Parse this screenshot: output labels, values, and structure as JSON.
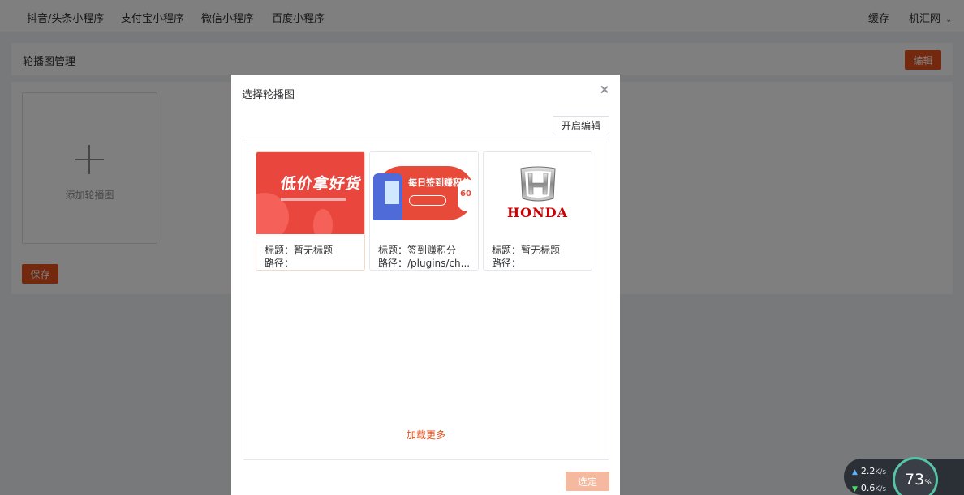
{
  "topnav": {
    "items": [
      "抖音/头条小程序",
      "支付宝小程序",
      "微信小程序",
      "百度小程序"
    ],
    "cache": "缓存",
    "account": "机汇网"
  },
  "panel": {
    "title": "轮播图管理",
    "edit_label": "编辑",
    "add_label": "添加轮播图",
    "save_label": "保存"
  },
  "dialog": {
    "title": "选择轮播图",
    "start_edit_label": "开启编辑",
    "load_more": "加载更多",
    "confirm_label": "选定",
    "cards": [
      {
        "title": "标题：暂无标题",
        "path": "路径：",
        "image_text": "低价拿好货"
      },
      {
        "title": "标题：签到赚积分",
        "path": "路径：/plugins/ch...",
        "image_text": "每日签到赚积分",
        "badge": "60"
      },
      {
        "title": "标题：暂无标题",
        "path": "路径：",
        "image_text": "HONDA"
      }
    ]
  },
  "net_widget": {
    "upload": "2.2",
    "download": "0.6",
    "unit": "K/s",
    "percent": "73",
    "percent_sign": "%"
  },
  "colors": {
    "accent": "#e8521c",
    "confirm_disabled": "#f5b99f",
    "honda_red": "#cc0000"
  }
}
